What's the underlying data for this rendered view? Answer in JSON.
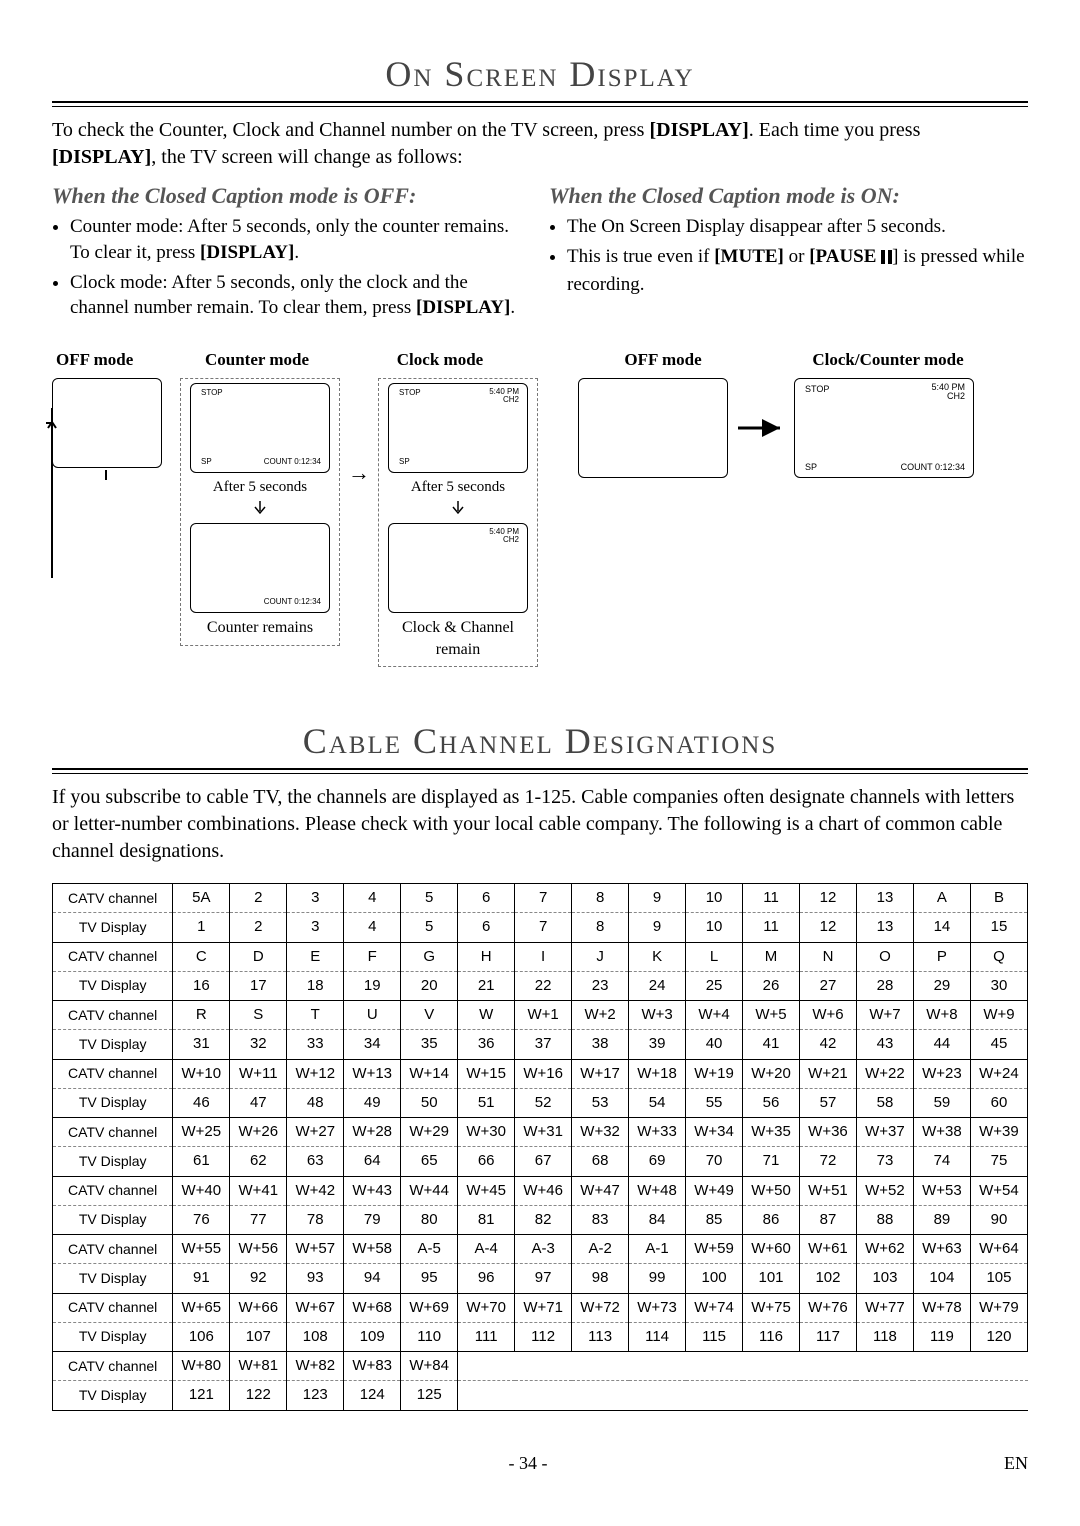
{
  "section1": {
    "title": "On Screen Display",
    "intro_a": "To check the Counter, Clock and Channel number on the TV screen, press ",
    "intro_b": ". Each time you press ",
    "intro_c": ", the TV screen will change as follows:",
    "display_kw": "[DISPLAY]",
    "cc_off_head": "When the Closed Caption mode is OFF:",
    "cc_off_b1a": "Counter mode: After 5 seconds, only the counter remains. To clear it, press ",
    "cc_off_b1b": ".",
    "cc_off_b2a": "Clock mode: After 5 seconds, only the clock and the channel number remain. To clear them, press ",
    "cc_off_b2b": ".",
    "cc_on_head": "When the Closed Caption mode is ON:",
    "cc_on_b1": "The On Screen Display disappear after 5 seconds.",
    "cc_on_b2a": "This is true even if ",
    "cc_on_b2_mute": "[MUTE]",
    "cc_on_b2_or": " or ",
    "cc_on_b2_pause": "[PAUSE ",
    "cc_on_b2b": "] is pressed while recording.",
    "labels": {
      "off_mode": "OFF mode",
      "counter_mode": "Counter mode",
      "clock_mode": "Clock mode",
      "clock_counter_mode": "Clock/Counter mode",
      "after5": "After 5 seconds",
      "counter_remains": "Counter remains",
      "clockchan_remain": "Clock & Channel remain"
    },
    "osd": {
      "stop": "STOP",
      "sp": "SP",
      "count": "COUNT 0:12:34",
      "time": "5:40 PM",
      "ch": "CH2"
    }
  },
  "section2": {
    "title": "Cable Channel Designations",
    "intro": "If you subscribe to cable TV, the channels are displayed as 1-125. Cable companies often designate channels with letters or letter-number combinations. Please check with your local cable company. The following is a chart of common cable channel designations.",
    "row_label_catv": "CATV channel",
    "row_label_tv": "TV Display",
    "rows": [
      {
        "catv": [
          "5A",
          "2",
          "3",
          "4",
          "5",
          "6",
          "7",
          "8",
          "9",
          "10",
          "11",
          "12",
          "13",
          "A",
          "B"
        ],
        "tv": [
          "1",
          "2",
          "3",
          "4",
          "5",
          "6",
          "7",
          "8",
          "9",
          "10",
          "11",
          "12",
          "13",
          "14",
          "15"
        ]
      },
      {
        "catv": [
          "C",
          "D",
          "E",
          "F",
          "G",
          "H",
          "I",
          "J",
          "K",
          "L",
          "M",
          "N",
          "O",
          "P",
          "Q"
        ],
        "tv": [
          "16",
          "17",
          "18",
          "19",
          "20",
          "21",
          "22",
          "23",
          "24",
          "25",
          "26",
          "27",
          "28",
          "29",
          "30"
        ]
      },
      {
        "catv": [
          "R",
          "S",
          "T",
          "U",
          "V",
          "W",
          "W+1",
          "W+2",
          "W+3",
          "W+4",
          "W+5",
          "W+6",
          "W+7",
          "W+8",
          "W+9"
        ],
        "tv": [
          "31",
          "32",
          "33",
          "34",
          "35",
          "36",
          "37",
          "38",
          "39",
          "40",
          "41",
          "42",
          "43",
          "44",
          "45"
        ]
      },
      {
        "catv": [
          "W+10",
          "W+11",
          "W+12",
          "W+13",
          "W+14",
          "W+15",
          "W+16",
          "W+17",
          "W+18",
          "W+19",
          "W+20",
          "W+21",
          "W+22",
          "W+23",
          "W+24"
        ],
        "tv": [
          "46",
          "47",
          "48",
          "49",
          "50",
          "51",
          "52",
          "53",
          "54",
          "55",
          "56",
          "57",
          "58",
          "59",
          "60"
        ]
      },
      {
        "catv": [
          "W+25",
          "W+26",
          "W+27",
          "W+28",
          "W+29",
          "W+30",
          "W+31",
          "W+32",
          "W+33",
          "W+34",
          "W+35",
          "W+36",
          "W+37",
          "W+38",
          "W+39"
        ],
        "tv": [
          "61",
          "62",
          "63",
          "64",
          "65",
          "66",
          "67",
          "68",
          "69",
          "70",
          "71",
          "72",
          "73",
          "74",
          "75"
        ]
      },
      {
        "catv": [
          "W+40",
          "W+41",
          "W+42",
          "W+43",
          "W+44",
          "W+45",
          "W+46",
          "W+47",
          "W+48",
          "W+49",
          "W+50",
          "W+51",
          "W+52",
          "W+53",
          "W+54"
        ],
        "tv": [
          "76",
          "77",
          "78",
          "79",
          "80",
          "81",
          "82",
          "83",
          "84",
          "85",
          "86",
          "87",
          "88",
          "89",
          "90"
        ]
      },
      {
        "catv": [
          "W+55",
          "W+56",
          "W+57",
          "W+58",
          "A-5",
          "A-4",
          "A-3",
          "A-2",
          "A-1",
          "W+59",
          "W+60",
          "W+61",
          "W+62",
          "W+63",
          "W+64"
        ],
        "tv": [
          "91",
          "92",
          "93",
          "94",
          "95",
          "96",
          "97",
          "98",
          "99",
          "100",
          "101",
          "102",
          "103",
          "104",
          "105"
        ]
      },
      {
        "catv": [
          "W+65",
          "W+66",
          "W+67",
          "W+68",
          "W+69",
          "W+70",
          "W+71",
          "W+72",
          "W+73",
          "W+74",
          "W+75",
          "W+76",
          "W+77",
          "W+78",
          "W+79"
        ],
        "tv": [
          "106",
          "107",
          "108",
          "109",
          "110",
          "111",
          "112",
          "113",
          "114",
          "115",
          "116",
          "117",
          "118",
          "119",
          "120"
        ]
      },
      {
        "catv": [
          "W+80",
          "W+81",
          "W+82",
          "W+83",
          "W+84"
        ],
        "tv": [
          "121",
          "122",
          "123",
          "124",
          "125"
        ]
      }
    ]
  },
  "footer": {
    "page": "- 34 -",
    "lang": "EN"
  }
}
